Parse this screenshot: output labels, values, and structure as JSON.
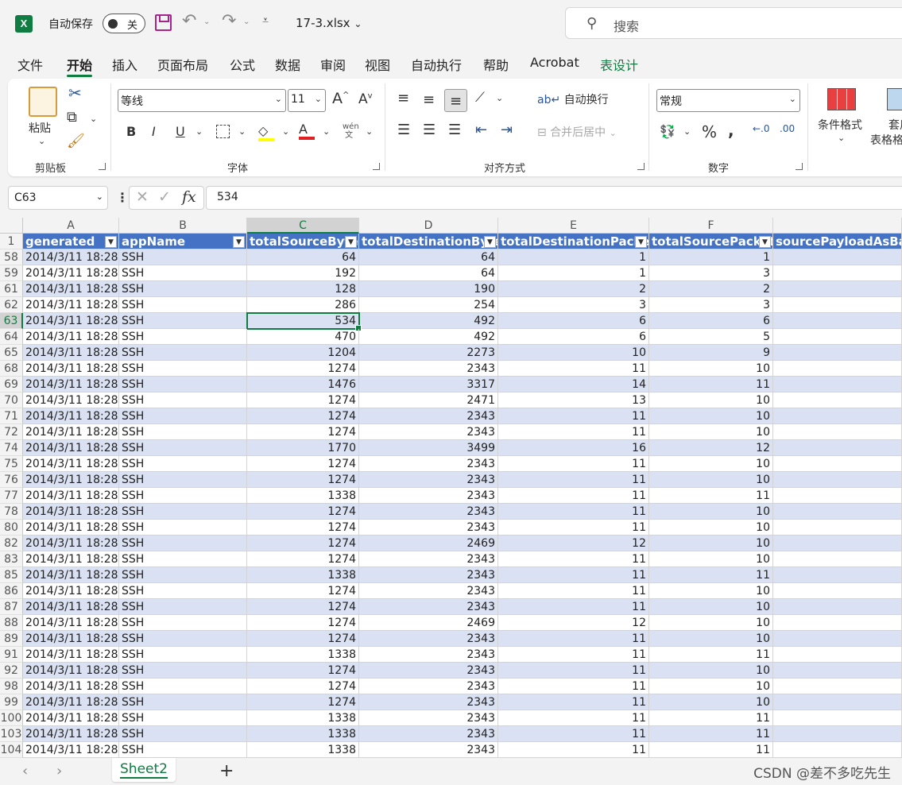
{
  "titlebar": {
    "app_icon": "excel-icon",
    "autosave_label": "自动保存",
    "autosave_state": "关",
    "file_name": "17-3.xlsx",
    "search_placeholder": "搜索"
  },
  "tabs": [
    "文件",
    "开始",
    "插入",
    "页面布局",
    "公式",
    "数据",
    "审阅",
    "视图",
    "自动执行",
    "帮助",
    "Acrobat",
    "表设计"
  ],
  "active_tab": "开始",
  "ribbon": {
    "clipboard": {
      "label": "剪贴板",
      "paste": "粘贴"
    },
    "font": {
      "label": "字体",
      "name": "等线",
      "size": "11"
    },
    "alignment": {
      "label": "对齐方式",
      "wrap": "自动换行",
      "merge": "合并后居中"
    },
    "number": {
      "label": "数字",
      "format": "常规"
    },
    "styles": {
      "cond_format": "条件格式",
      "table_format_1": "套用",
      "table_format_2": "表格格式"
    }
  },
  "formula_bar": {
    "name_box": "C63",
    "fx": "fx",
    "value": "534"
  },
  "columns": [
    "A",
    "B",
    "C",
    "D",
    "E",
    "F",
    ""
  ],
  "selected_column": "C",
  "table": {
    "headers": [
      "generated",
      "appName",
      "totalSourceByte",
      "totalDestinationByte",
      "totalDestinationPacket",
      "totalSourcePacket",
      "sourcePayloadAsBase"
    ],
    "header_row_number": "1",
    "rows": [
      {
        "n": "58",
        "cells": [
          "2014/3/11 18:28",
          "SSH",
          "64",
          "64",
          "1",
          "1"
        ]
      },
      {
        "n": "59",
        "cells": [
          "2014/3/11 18:28",
          "SSH",
          "192",
          "64",
          "1",
          "3"
        ]
      },
      {
        "n": "61",
        "cells": [
          "2014/3/11 18:28",
          "SSH",
          "128",
          "190",
          "2",
          "2"
        ]
      },
      {
        "n": "62",
        "cells": [
          "2014/3/11 18:28",
          "SSH",
          "286",
          "254",
          "3",
          "3"
        ]
      },
      {
        "n": "63",
        "cells": [
          "2014/3/11 18:28",
          "SSH",
          "534",
          "492",
          "6",
          "6"
        ]
      },
      {
        "n": "64",
        "cells": [
          "2014/3/11 18:28",
          "SSH",
          "470",
          "492",
          "6",
          "5"
        ]
      },
      {
        "n": "65",
        "cells": [
          "2014/3/11 18:28",
          "SSH",
          "1204",
          "2273",
          "10",
          "9"
        ]
      },
      {
        "n": "68",
        "cells": [
          "2014/3/11 18:28",
          "SSH",
          "1274",
          "2343",
          "11",
          "10"
        ]
      },
      {
        "n": "69",
        "cells": [
          "2014/3/11 18:28",
          "SSH",
          "1476",
          "3317",
          "14",
          "11"
        ]
      },
      {
        "n": "70",
        "cells": [
          "2014/3/11 18:28",
          "SSH",
          "1274",
          "2471",
          "13",
          "10"
        ]
      },
      {
        "n": "71",
        "cells": [
          "2014/3/11 18:28",
          "SSH",
          "1274",
          "2343",
          "11",
          "10"
        ]
      },
      {
        "n": "72",
        "cells": [
          "2014/3/11 18:28",
          "SSH",
          "1274",
          "2343",
          "11",
          "10"
        ]
      },
      {
        "n": "74",
        "cells": [
          "2014/3/11 18:28",
          "SSH",
          "1770",
          "3499",
          "16",
          "12"
        ]
      },
      {
        "n": "75",
        "cells": [
          "2014/3/11 18:28",
          "SSH",
          "1274",
          "2343",
          "11",
          "10"
        ]
      },
      {
        "n": "76",
        "cells": [
          "2014/3/11 18:28",
          "SSH",
          "1274",
          "2343",
          "11",
          "10"
        ]
      },
      {
        "n": "77",
        "cells": [
          "2014/3/11 18:28",
          "SSH",
          "1338",
          "2343",
          "11",
          "11"
        ]
      },
      {
        "n": "78",
        "cells": [
          "2014/3/11 18:28",
          "SSH",
          "1274",
          "2343",
          "11",
          "10"
        ]
      },
      {
        "n": "80",
        "cells": [
          "2014/3/11 18:28",
          "SSH",
          "1274",
          "2343",
          "11",
          "10"
        ]
      },
      {
        "n": "82",
        "cells": [
          "2014/3/11 18:28",
          "SSH",
          "1274",
          "2469",
          "12",
          "10"
        ]
      },
      {
        "n": "83",
        "cells": [
          "2014/3/11 18:28",
          "SSH",
          "1274",
          "2343",
          "11",
          "10"
        ]
      },
      {
        "n": "85",
        "cells": [
          "2014/3/11 18:28",
          "SSH",
          "1338",
          "2343",
          "11",
          "11"
        ]
      },
      {
        "n": "86",
        "cells": [
          "2014/3/11 18:28",
          "SSH",
          "1274",
          "2343",
          "11",
          "10"
        ]
      },
      {
        "n": "87",
        "cells": [
          "2014/3/11 18:28",
          "SSH",
          "1274",
          "2343",
          "11",
          "10"
        ]
      },
      {
        "n": "88",
        "cells": [
          "2014/3/11 18:28",
          "SSH",
          "1274",
          "2469",
          "12",
          "10"
        ]
      },
      {
        "n": "89",
        "cells": [
          "2014/3/11 18:28",
          "SSH",
          "1274",
          "2343",
          "11",
          "10"
        ]
      },
      {
        "n": "91",
        "cells": [
          "2014/3/11 18:28",
          "SSH",
          "1338",
          "2343",
          "11",
          "11"
        ]
      },
      {
        "n": "92",
        "cells": [
          "2014/3/11 18:28",
          "SSH",
          "1274",
          "2343",
          "11",
          "10"
        ]
      },
      {
        "n": "98",
        "cells": [
          "2014/3/11 18:28",
          "SSH",
          "1274",
          "2343",
          "11",
          "10"
        ]
      },
      {
        "n": "99",
        "cells": [
          "2014/3/11 18:28",
          "SSH",
          "1274",
          "2343",
          "11",
          "10"
        ]
      },
      {
        "n": "100",
        "cells": [
          "2014/3/11 18:28",
          "SSH",
          "1338",
          "2343",
          "11",
          "11"
        ]
      },
      {
        "n": "103",
        "cells": [
          "2014/3/11 18:28",
          "SSH",
          "1338",
          "2343",
          "11",
          "11"
        ]
      },
      {
        "n": "104",
        "cells": [
          "2014/3/11 18:28",
          "SSH",
          "1338",
          "2343",
          "11",
          "11"
        ]
      }
    ]
  },
  "active_cell": {
    "row": "63",
    "column": "C"
  },
  "status": {
    "sheet_tab": "Sheet2",
    "watermark": "CSDN @差不多吃先生"
  },
  "colors": {
    "accent": "#107c41",
    "table_header": "#4472c4",
    "band": "#d9e1f2"
  }
}
